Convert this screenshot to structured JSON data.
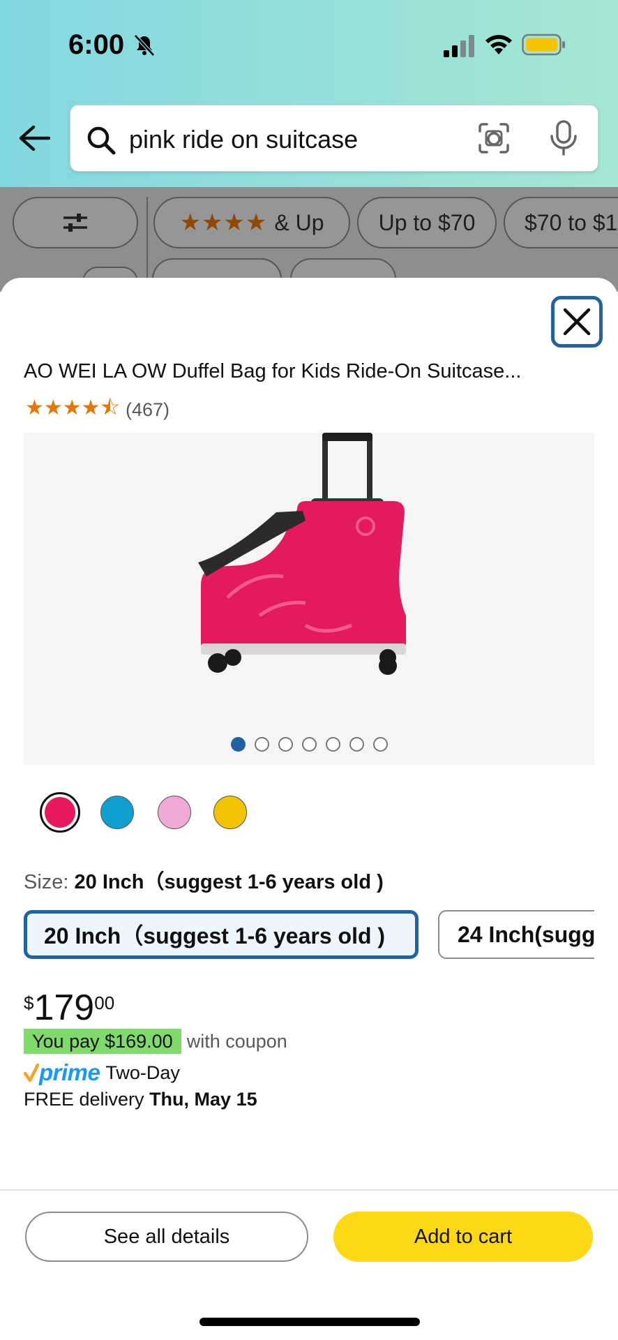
{
  "status_bar": {
    "time": "6:00"
  },
  "search": {
    "query": "pink ride on suitcase"
  },
  "filters": {
    "chips": [
      "★★★★ & Up",
      "Up to $70",
      "$70 to $1"
    ],
    "star_chip_stars": "★★★★",
    "star_chip_label": "& Up"
  },
  "product": {
    "title": "AO WEI LA OW Duffel Bag for Kids Ride-On Suitcase...",
    "rating_stars": "★★★★⯪",
    "rating_count": "(467)",
    "image_dots_total": 7,
    "image_dot_active": 1,
    "swatch_colors": [
      "#e8185c",
      "#0fa0cf",
      "#eeaad4",
      "#f2c300"
    ],
    "size_label": "Size:",
    "size_value": "20 Inch（suggest 1-6 years old )",
    "size_options": [
      "20 Inch（suggest 1-6 years old )",
      "24 Inch(sugg"
    ],
    "price_symbol": "$",
    "price_whole": "179",
    "price_fraction": "00",
    "coupon_badge": "You pay $169.00",
    "coupon_text": "with coupon",
    "prime_word": "prime",
    "prime_speed": "Two-Day",
    "delivery_prefix": "FREE delivery",
    "delivery_date": "Thu, May 15"
  },
  "actions": {
    "details": "See all details",
    "add_to_cart": "Add to cart"
  },
  "colors": {
    "prime_blue": "#1a98ff",
    "accent_blue": "#2162a1",
    "cart_yellow": "#ffd814",
    "coupon_green": "#7fda69"
  }
}
